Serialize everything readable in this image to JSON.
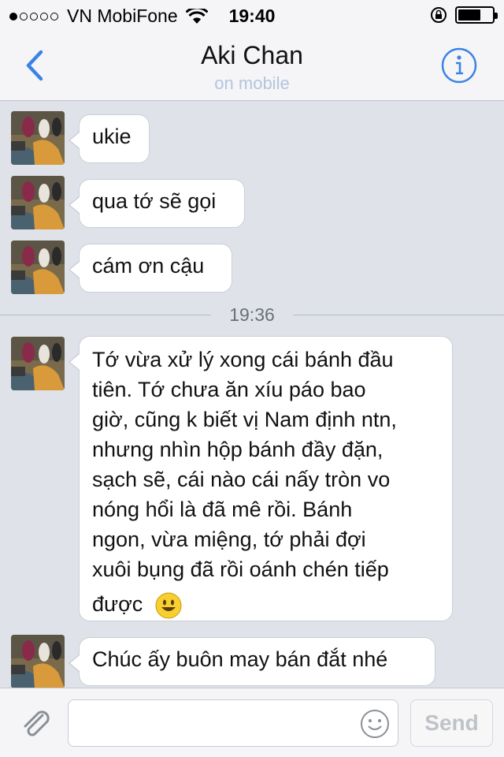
{
  "status_bar": {
    "signal_dots_filled": 1,
    "signal_dots_total": 5,
    "carrier": "VN MobiFone",
    "time": "19:40"
  },
  "nav": {
    "title": "Aki Chan",
    "subtitle": "on mobile",
    "back_icon": "chevron-left-icon",
    "info_icon": "info-icon",
    "accent_color": "#3b82e6"
  },
  "messages": [
    {
      "text": "ukie"
    },
    {
      "text": "qua tớ sẽ gọi"
    },
    {
      "text": "cám ơn cậu"
    }
  ],
  "divider_time": "19:36",
  "long_message": {
    "lines": [
      "Tớ vừa xử lý xong cái bánh đầu",
      "tiên. Tớ chưa ăn xíu páo bao",
      "giờ, cũng k biết vị Nam định ntn,",
      "nhưng nhìn hộp bánh đầy đặn,",
      "sạch sẽ, cái nào cái nấy tròn vo",
      "nóng hổi là đã mê rồi. Bánh",
      "ngon, vừa miệng, tớ phải đợi",
      "xuôi bụng đã rồi oánh chén tiếp",
      "được"
    ],
    "emoji": "smiley-face-icon"
  },
  "last_message": {
    "text": "Chúc ấy buôn may bán đắt nhé"
  },
  "input": {
    "value": "",
    "placeholder": "",
    "send_label": "Send",
    "attach_icon": "paperclip-icon",
    "emoji_icon": "smiley-icon"
  }
}
